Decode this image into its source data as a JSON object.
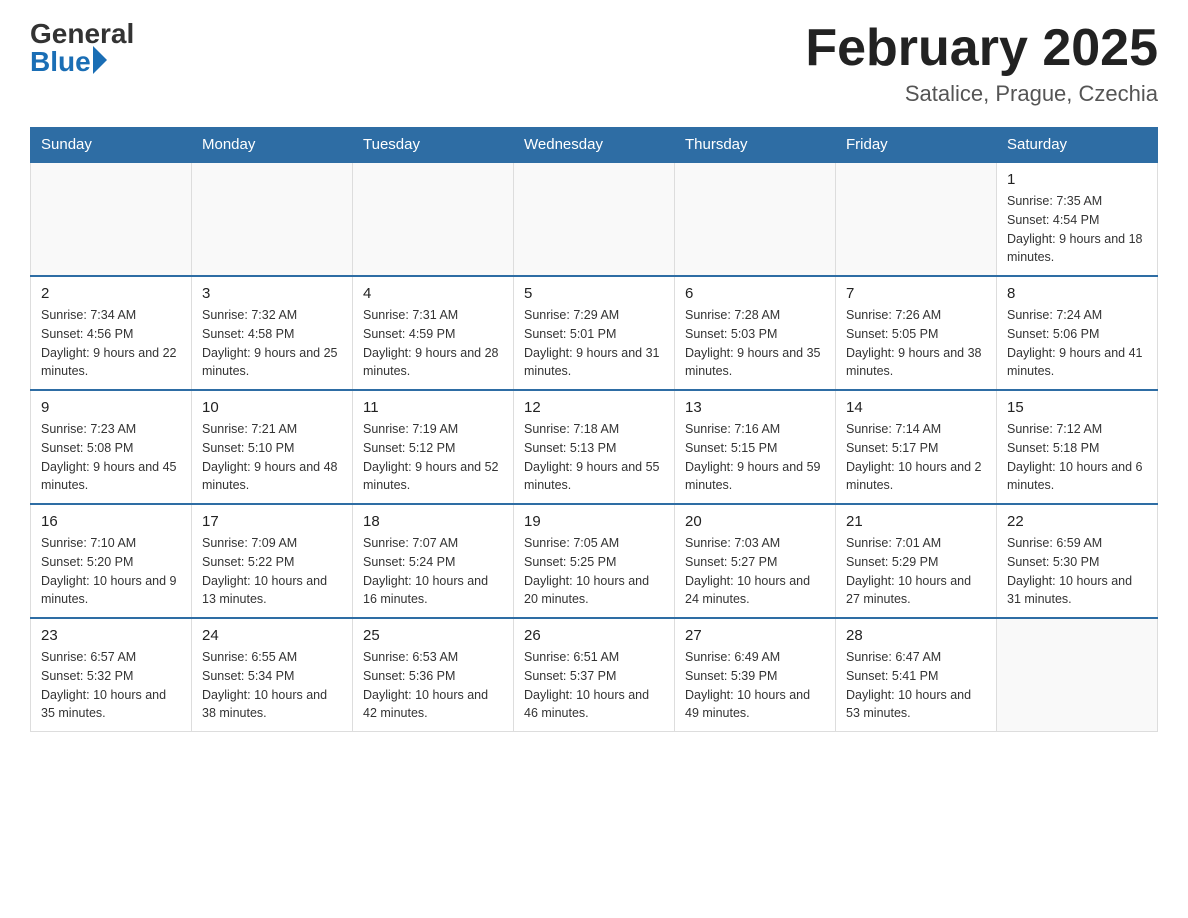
{
  "logo": {
    "general": "General",
    "blue": "Blue"
  },
  "title": {
    "month": "February 2025",
    "location": "Satalice, Prague, Czechia"
  },
  "weekdays": [
    "Sunday",
    "Monday",
    "Tuesday",
    "Wednesday",
    "Thursday",
    "Friday",
    "Saturday"
  ],
  "weeks": [
    [
      {
        "day": "",
        "info": ""
      },
      {
        "day": "",
        "info": ""
      },
      {
        "day": "",
        "info": ""
      },
      {
        "day": "",
        "info": ""
      },
      {
        "day": "",
        "info": ""
      },
      {
        "day": "",
        "info": ""
      },
      {
        "day": "1",
        "info": "Sunrise: 7:35 AM\nSunset: 4:54 PM\nDaylight: 9 hours and 18 minutes."
      }
    ],
    [
      {
        "day": "2",
        "info": "Sunrise: 7:34 AM\nSunset: 4:56 PM\nDaylight: 9 hours and 22 minutes."
      },
      {
        "day": "3",
        "info": "Sunrise: 7:32 AM\nSunset: 4:58 PM\nDaylight: 9 hours and 25 minutes."
      },
      {
        "day": "4",
        "info": "Sunrise: 7:31 AM\nSunset: 4:59 PM\nDaylight: 9 hours and 28 minutes."
      },
      {
        "day": "5",
        "info": "Sunrise: 7:29 AM\nSunset: 5:01 PM\nDaylight: 9 hours and 31 minutes."
      },
      {
        "day": "6",
        "info": "Sunrise: 7:28 AM\nSunset: 5:03 PM\nDaylight: 9 hours and 35 minutes."
      },
      {
        "day": "7",
        "info": "Sunrise: 7:26 AM\nSunset: 5:05 PM\nDaylight: 9 hours and 38 minutes."
      },
      {
        "day": "8",
        "info": "Sunrise: 7:24 AM\nSunset: 5:06 PM\nDaylight: 9 hours and 41 minutes."
      }
    ],
    [
      {
        "day": "9",
        "info": "Sunrise: 7:23 AM\nSunset: 5:08 PM\nDaylight: 9 hours and 45 minutes."
      },
      {
        "day": "10",
        "info": "Sunrise: 7:21 AM\nSunset: 5:10 PM\nDaylight: 9 hours and 48 minutes."
      },
      {
        "day": "11",
        "info": "Sunrise: 7:19 AM\nSunset: 5:12 PM\nDaylight: 9 hours and 52 minutes."
      },
      {
        "day": "12",
        "info": "Sunrise: 7:18 AM\nSunset: 5:13 PM\nDaylight: 9 hours and 55 minutes."
      },
      {
        "day": "13",
        "info": "Sunrise: 7:16 AM\nSunset: 5:15 PM\nDaylight: 9 hours and 59 minutes."
      },
      {
        "day": "14",
        "info": "Sunrise: 7:14 AM\nSunset: 5:17 PM\nDaylight: 10 hours and 2 minutes."
      },
      {
        "day": "15",
        "info": "Sunrise: 7:12 AM\nSunset: 5:18 PM\nDaylight: 10 hours and 6 minutes."
      }
    ],
    [
      {
        "day": "16",
        "info": "Sunrise: 7:10 AM\nSunset: 5:20 PM\nDaylight: 10 hours and 9 minutes."
      },
      {
        "day": "17",
        "info": "Sunrise: 7:09 AM\nSunset: 5:22 PM\nDaylight: 10 hours and 13 minutes."
      },
      {
        "day": "18",
        "info": "Sunrise: 7:07 AM\nSunset: 5:24 PM\nDaylight: 10 hours and 16 minutes."
      },
      {
        "day": "19",
        "info": "Sunrise: 7:05 AM\nSunset: 5:25 PM\nDaylight: 10 hours and 20 minutes."
      },
      {
        "day": "20",
        "info": "Sunrise: 7:03 AM\nSunset: 5:27 PM\nDaylight: 10 hours and 24 minutes."
      },
      {
        "day": "21",
        "info": "Sunrise: 7:01 AM\nSunset: 5:29 PM\nDaylight: 10 hours and 27 minutes."
      },
      {
        "day": "22",
        "info": "Sunrise: 6:59 AM\nSunset: 5:30 PM\nDaylight: 10 hours and 31 minutes."
      }
    ],
    [
      {
        "day": "23",
        "info": "Sunrise: 6:57 AM\nSunset: 5:32 PM\nDaylight: 10 hours and 35 minutes."
      },
      {
        "day": "24",
        "info": "Sunrise: 6:55 AM\nSunset: 5:34 PM\nDaylight: 10 hours and 38 minutes."
      },
      {
        "day": "25",
        "info": "Sunrise: 6:53 AM\nSunset: 5:36 PM\nDaylight: 10 hours and 42 minutes."
      },
      {
        "day": "26",
        "info": "Sunrise: 6:51 AM\nSunset: 5:37 PM\nDaylight: 10 hours and 46 minutes."
      },
      {
        "day": "27",
        "info": "Sunrise: 6:49 AM\nSunset: 5:39 PM\nDaylight: 10 hours and 49 minutes."
      },
      {
        "day": "28",
        "info": "Sunrise: 6:47 AM\nSunset: 5:41 PM\nDaylight: 10 hours and 53 minutes."
      },
      {
        "day": "",
        "info": ""
      }
    ]
  ]
}
